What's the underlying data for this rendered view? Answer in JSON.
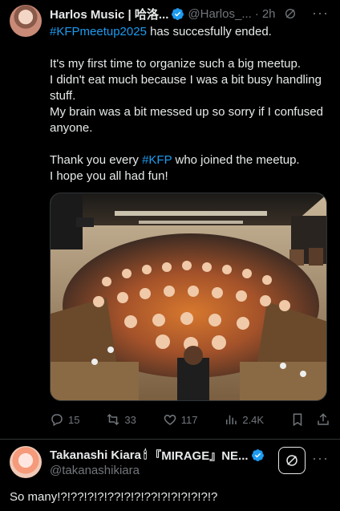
{
  "tweet": {
    "author_name": "Harlos Music | 哈洛...",
    "author_handle": "@Harlos_...",
    "separator": "·",
    "time": "2h",
    "more": "···",
    "body": [
      {
        "tag": "#KFPmeetup2025",
        "text": " has succesfully ended."
      },
      {
        "text": "It's my first time to organize such a big meetup."
      },
      {
        "text": "I didn't eat much because I was a bit busy handling stuff."
      },
      {
        "text": "My brain was a bit messed up so sorry if I confused anyone."
      },
      {
        "pre": "Thank you every ",
        "tag": "#KFP",
        "post": " who joined the meetup."
      },
      {
        "text": "I hope you all had fun!"
      }
    ],
    "stats": {
      "replies": "15",
      "reposts": "33",
      "likes": "117",
      "views": "2.4K"
    }
  },
  "reply": {
    "author_name": "Takanashi Kiara",
    "author_suffix": "『MIRAGE』NE...",
    "author_handle": "@takanashikiara",
    "more": "···",
    "text": "So many!?!??!?!?!??!?!?!??!?!?!?!?!?!?"
  },
  "colors": {
    "background": "#000000",
    "text": "#e7e9ea",
    "muted": "#71767b",
    "accent": "#1d9bf0",
    "divider": "#2f3336"
  }
}
